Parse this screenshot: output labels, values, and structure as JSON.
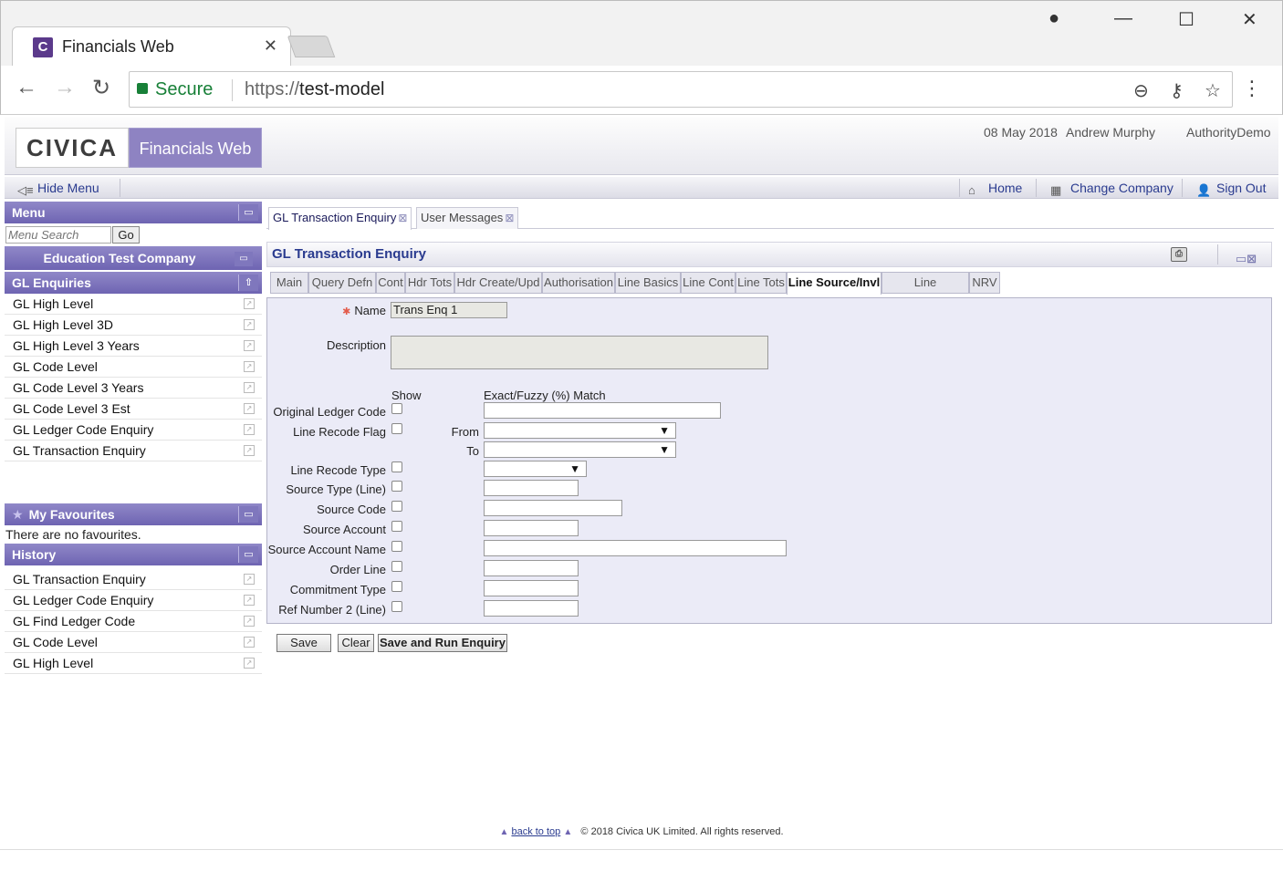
{
  "browser": {
    "tab_title": "Financials Web",
    "secure_label": "Secure",
    "url_protocol": "https://",
    "url_host": "test-model"
  },
  "header": {
    "logo_text": "CIVICA",
    "app_name": "Financials Web",
    "date": "08 May 2018",
    "user": "Andrew Murphy",
    "authority": "AuthorityDemo"
  },
  "menubar": {
    "hide_menu": "Hide Menu",
    "home": "Home",
    "change_company": "Change Company",
    "sign_out": "Sign Out"
  },
  "sidebar": {
    "menu_title": "Menu",
    "search_placeholder": "Menu Search",
    "go_label": "Go",
    "company": "Education Test Company",
    "section_title": "GL Enquiries",
    "items": [
      "GL High Level",
      "GL High Level 3D",
      "GL High Level 3 Years",
      "GL Code Level",
      "GL Code Level 3 Years",
      "GL Code Level 3 Est",
      "GL Ledger Code Enquiry",
      "GL Transaction Enquiry"
    ],
    "favourites_title": "My Favourites",
    "favourites_empty": "There are no favourites.",
    "history_title": "History",
    "history": [
      "GL Transaction Enquiry",
      "GL Ledger Code Enquiry",
      "GL Find Ledger Code",
      "GL Code Level",
      "GL High Level"
    ]
  },
  "content": {
    "tabs": [
      "GL Transaction Enquiry",
      "User Messages"
    ],
    "title": "GL Transaction Enquiry",
    "subtabs": [
      "Main",
      "Query Defn",
      "Cont",
      "Hdr Tots",
      "Hdr Create/Upd",
      "Authorisation",
      "Line Basics",
      "Line Cont",
      "Line Tots",
      "Line Source/Invl",
      "Line Create/Upd",
      "NRV"
    ],
    "active_subtab": "Line Source/Invl"
  },
  "form": {
    "name_label": "Name",
    "name_value": "Trans Enq 1",
    "description_label": "Description",
    "show_header": "Show",
    "match_header": "Exact/Fuzzy (%) Match",
    "original_ledger_code": "Original Ledger Code",
    "line_recode_flag": "Line Recode Flag",
    "from_label": "From",
    "to_label": "To",
    "line_recode_type": "Line Recode Type",
    "source_type_line": "Source Type (Line)",
    "source_code": "Source Code",
    "source_account": "Source Account",
    "source_account_name": "Source Account Name",
    "order_line": "Order Line",
    "commitment_type": "Commitment Type",
    "ref_number_2": "Ref Number 2 (Line)"
  },
  "buttons": {
    "save": "Save",
    "clear": "Clear",
    "save_run": "Save and Run Enquiry"
  },
  "footer": {
    "back_to_top": "back to top",
    "copyright": "© 2018 Civica UK Limited. All rights reserved."
  }
}
